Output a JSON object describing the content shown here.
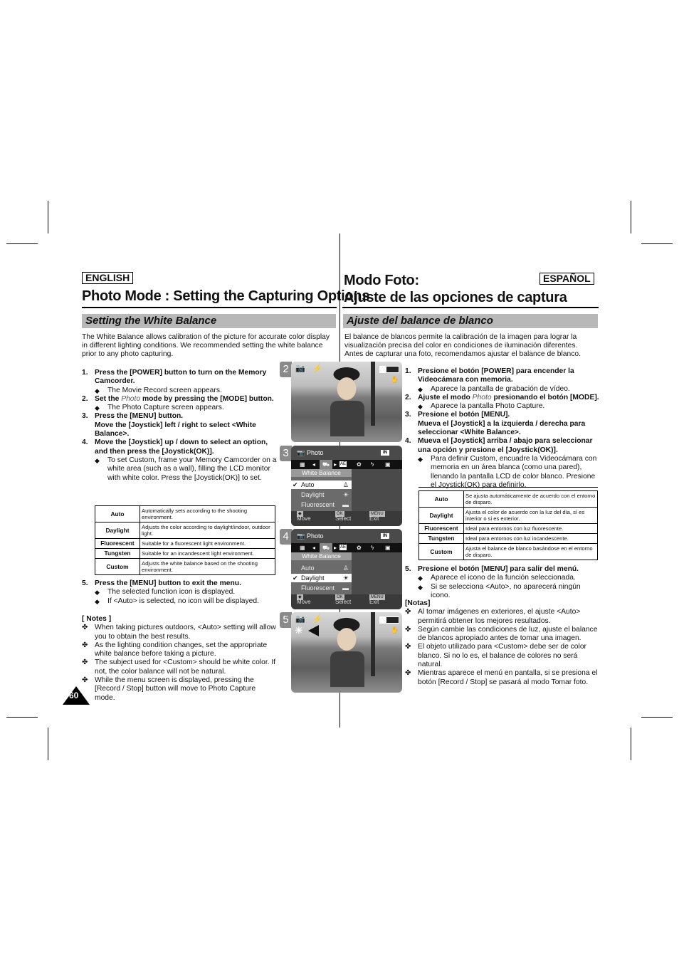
{
  "english": {
    "lang_label": "ENGLISH",
    "title": "Photo Mode : Setting the Capturing Options",
    "section": "Setting the White Balance",
    "intro": "The White Balance allows calibration of the picture for accurate color display in different lighting conditions. We recommended setting the white balance prior to any photo capturing.",
    "steps": [
      {
        "num": "1.",
        "text": "Press the [POWER] button to turn on the Memory Camcorder.",
        "subs": [
          "The Movie Record screen appears."
        ]
      },
      {
        "num": "2.",
        "text_pre": "Set the ",
        "text_em": "Photo",
        "text_post": " mode by pressing the [MODE] button.",
        "subs": [
          "The Photo Capture screen appears."
        ]
      },
      {
        "num": "3.",
        "text": "Press the [MENU] button.",
        "text2": "Move the [Joystick] left / right to select <White Balance>.",
        "subs": []
      },
      {
        "num": "4.",
        "text": "Move the [Joystick] up / down to select an option, and then press the [Joystick(OK)].",
        "subs": [
          "To set Custom, frame  your Memory Camcorder on a white area (such as a wall), filling the LCD monitor with white color. Press the [Joystick(OK)] to set."
        ]
      },
      {
        "num": "5.",
        "text": "Press the [MENU] button to exit the menu.",
        "subs": [
          "The selected function icon is displayed.",
          "If <Auto> is selected, no icon will be displayed."
        ]
      }
    ],
    "table": [
      {
        "key": "Auto",
        "desc": "Automatically sets according to the shooting environment."
      },
      {
        "key": "Daylight",
        "desc": "Adjusts the color according to daylight/indoor, outdoor light."
      },
      {
        "key": "Fluorescent",
        "desc": "Suitable for a fluorescent light environment."
      },
      {
        "key": "Tungsten",
        "desc": "Suitable for an incandescent light environment."
      },
      {
        "key": "Custom",
        "desc": "Adjusts the white balance based on the shooting environment."
      }
    ],
    "notes_title": "[ Notes ]",
    "notes": [
      "When taking pictures outdoors, <Auto> setting will allow you to obtain the best results.",
      "As the lighting condition changes, set the appropriate white balance before taking a picture.",
      "The subject used for <Custom> should be white color. If not, the color balance will not be natural.",
      "While the menu screen is displayed, pressing the [Record / Stop] button will move to Photo Capture mode."
    ]
  },
  "espanol": {
    "lang_label": "ESPAÑOL",
    "title_line1": "Modo Foto:",
    "title_line2": "Ajuste de las opciones de captura",
    "section": "Ajuste del balance de blanco",
    "intro": "El balance de blancos permite la calibración de la imagen para lograr la visualización precisa del color en condiciones de iluminación diferentes. Antes de capturar una foto, recomendamos ajustar el balance de blanco.",
    "steps": [
      {
        "num": "1.",
        "text": "Presione el botón [POWER] para encender la Videocámara con memoria.",
        "subs": [
          "Aparece la pantalla de grabación de vídeo."
        ]
      },
      {
        "num": "2.",
        "text_pre": "Ajuste el modo ",
        "text_em": "Photo",
        "text_post": " presionando el botón [MODE].",
        "subs": [
          "Aparece la pantalla Photo Capture."
        ]
      },
      {
        "num": "3.",
        "text": "Presione el botón [MENU].",
        "text2": "Mueva el [Joystick] a la izquierda / derecha para seleccionar <White Balance>.",
        "subs": []
      },
      {
        "num": "4.",
        "text": "Mueva el [Joystick] arriba / abajo para seleccionar una opción y presione el [Joystick(OK)].",
        "subs": [
          "Para definir Custom, encuadre la Videocámara con memoria en un área blanca (como una pared), llenando la pantalla LCD de color blanco. Presione el Joystick(OK) para definirlo."
        ]
      },
      {
        "num": "5.",
        "text": "Presione el botón [MENU] para salir del menú.",
        "subs": [
          "Aparece el icono de la función seleccionada.",
          "Si se selecciona <Auto>, no aparecerá ningún icono."
        ]
      }
    ],
    "table": [
      {
        "key": "Auto",
        "desc": "Se ajusta automáticamente de acuerdo con el entorno de disparo."
      },
      {
        "key": "Daylight",
        "desc": "Ajusta el color de acuerdo con la luz del día, sí es interior o si es exterior."
      },
      {
        "key": "Fluorescent",
        "desc": "Ideal para entornos con luz fluorescente."
      },
      {
        "key": "Tungsten",
        "desc": "Ideal para entornos con luz incandescente."
      },
      {
        "key": "Custom",
        "desc": "Ajusta el balance de blanco basándose en el entorno de disparo."
      }
    ],
    "notes_title": "[Notas]",
    "notes": [
      "Al tomar imágenes en exteriores, el ajuste <Auto> permitirá obtener los mejores resultados.",
      "Según cambie las condiciones de luz, ajuste el balance de blancos apropiado antes de tomar una imagen.",
      "El objeto utilizado para <Custom> debe ser de color blanco. Si no lo es, el balance de colores no será natural.",
      "Mientras aparece el menú en pantalla, si se presiona el botón [Record / Stop] se pasará al modo Tomar foto."
    ]
  },
  "screens": {
    "step_numbers": [
      "2",
      "3",
      "4",
      "5"
    ],
    "menu_header": "Photo",
    "menu_list_title": "White Balance",
    "menu_options": [
      "Auto",
      "Daylight",
      "Fluorescent"
    ],
    "screen3_selected": "Auto",
    "screen4_selected": "Daylight",
    "memory_badge": "IN",
    "footer_move": "Move",
    "footer_select": "Select",
    "footer_exit": "Exit",
    "btn_ok": "OK",
    "btn_menu": "MENU",
    "tab_ae": "AE",
    "checkmark": "✔"
  },
  "page_number": "60",
  "colors": {
    "section_bar": "#b8b8b8",
    "step_badge": "#8a8a8a",
    "osd_dark": "#111111"
  }
}
